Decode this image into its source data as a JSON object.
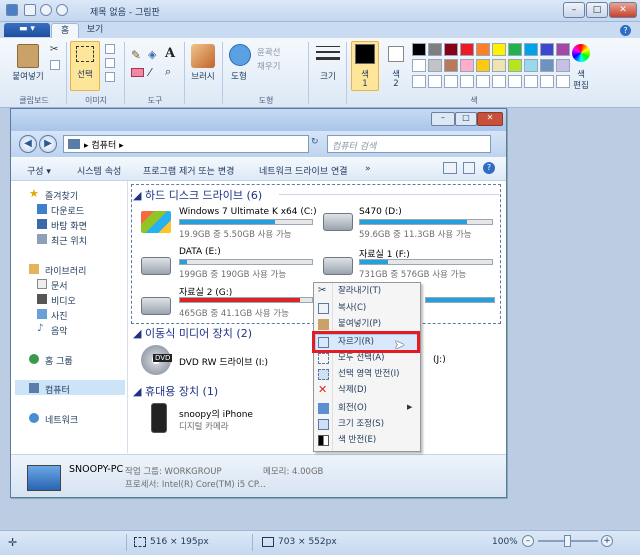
{
  "window": {
    "title": "제목 없음 - 그림판"
  },
  "ribbon": {
    "file_menu": "▬ ▾",
    "tabs": [
      "홈",
      "보기"
    ],
    "paste": "붙여넣기",
    "select": "선택",
    "brushes": "브러시",
    "shapes": "도형",
    "outline": "윤곽선",
    "fill": "채우기",
    "size": "크기",
    "color1": "색\n1",
    "color1_a": "색",
    "color1_b": "1",
    "color2_a": "색",
    "color2_b": "2",
    "edit_colors_a": "색",
    "edit_colors_b": "편집",
    "groups": [
      "클립보드",
      "이미지",
      "도구",
      "도형",
      "색"
    ],
    "palette": [
      "#000000",
      "#7f7f7f",
      "#880015",
      "#ed1c24",
      "#ff7f27",
      "#fff200",
      "#22b14c",
      "#00a2e8",
      "#3f48cc",
      "#a349a4",
      "#ffffff",
      "#c3c3c3",
      "#b97a57",
      "#ffaec9",
      "#ffc90e",
      "#efe4b0",
      "#b5e61d",
      "#99d9ea",
      "#7092be",
      "#c8bfe7"
    ]
  },
  "explorer": {
    "address": "컴퓨터",
    "search_placeholder": "컴퓨터 검색",
    "commands": [
      "구성 ▾",
      "시스템 속성",
      "프로그램 제거 또는 변경",
      "네트워크 드라이브 연결",
      "»"
    ],
    "nav": {
      "favorites": "즐겨찾기",
      "downloads": "다운로드",
      "desktop": "바탕 화면",
      "recent": "최근 위치",
      "libraries": "라이브러리",
      "documents": "문서",
      "videos": "비디오",
      "pictures": "사진",
      "music": "음악",
      "homegroup": "홈 그룹",
      "computer": "컴퓨터",
      "network": "네트워크"
    },
    "sections": {
      "hdd": "하드 디스크 드라이브 (6)",
      "removable": "이동식 미디어 장치 (2)",
      "portable": "휴대용 장치 (1)"
    },
    "drives": [
      {
        "name": "Windows 7 Ultimate K x64 (C:)",
        "free": "19.9GB 중 5.50GB 사용 가능",
        "used_pct": 72,
        "color": "#26a0da"
      },
      {
        "name": "S470 (D:)",
        "free": "59.6GB 중 11.3GB 사용 가능",
        "used_pct": 81,
        "color": "#26a0da"
      },
      {
        "name": "DATA (E:)",
        "free": "199GB 중 190GB 사용 가능",
        "used_pct": 5,
        "color": "#26a0da"
      },
      {
        "name": "자료실 1 (F:)",
        "free": "731GB 중 576GB 사용 가능",
        "used_pct": 21,
        "color": "#26a0da"
      },
      {
        "name": "자료실 2 (G:)",
        "free": "465GB 중 41.1GB 사용 가능",
        "used_pct": 91,
        "color": "#da2626"
      }
    ],
    "dvd": {
      "name": "DVD RW 드라이브 (I:)",
      "badge": "DVD",
      "right_label": "(J:)"
    },
    "device": {
      "name": "snoopy의 iPhone",
      "type": "디지털 카메라"
    },
    "status": {
      "pc": "SNOOPY-PC",
      "workgroup": "작업 그룹: WORKGROUP",
      "memory": "메모리: 4.00GB",
      "cpu": "프로세서: Intel(R) Core(TM) i5 CP..."
    }
  },
  "context_menu": [
    "잘라내기(T)",
    "복사(C)",
    "붙여넣기(P)",
    "자르기(R)",
    "모두 선택(A)",
    "선택 영역 반전(I)",
    "삭제(D)",
    "회전(O)",
    "크기 조정(S)",
    "색 반전(E)"
  ],
  "statusbar": {
    "selection": "516 × 195px",
    "canvas": "703 × 552px",
    "zoom": "100%"
  }
}
